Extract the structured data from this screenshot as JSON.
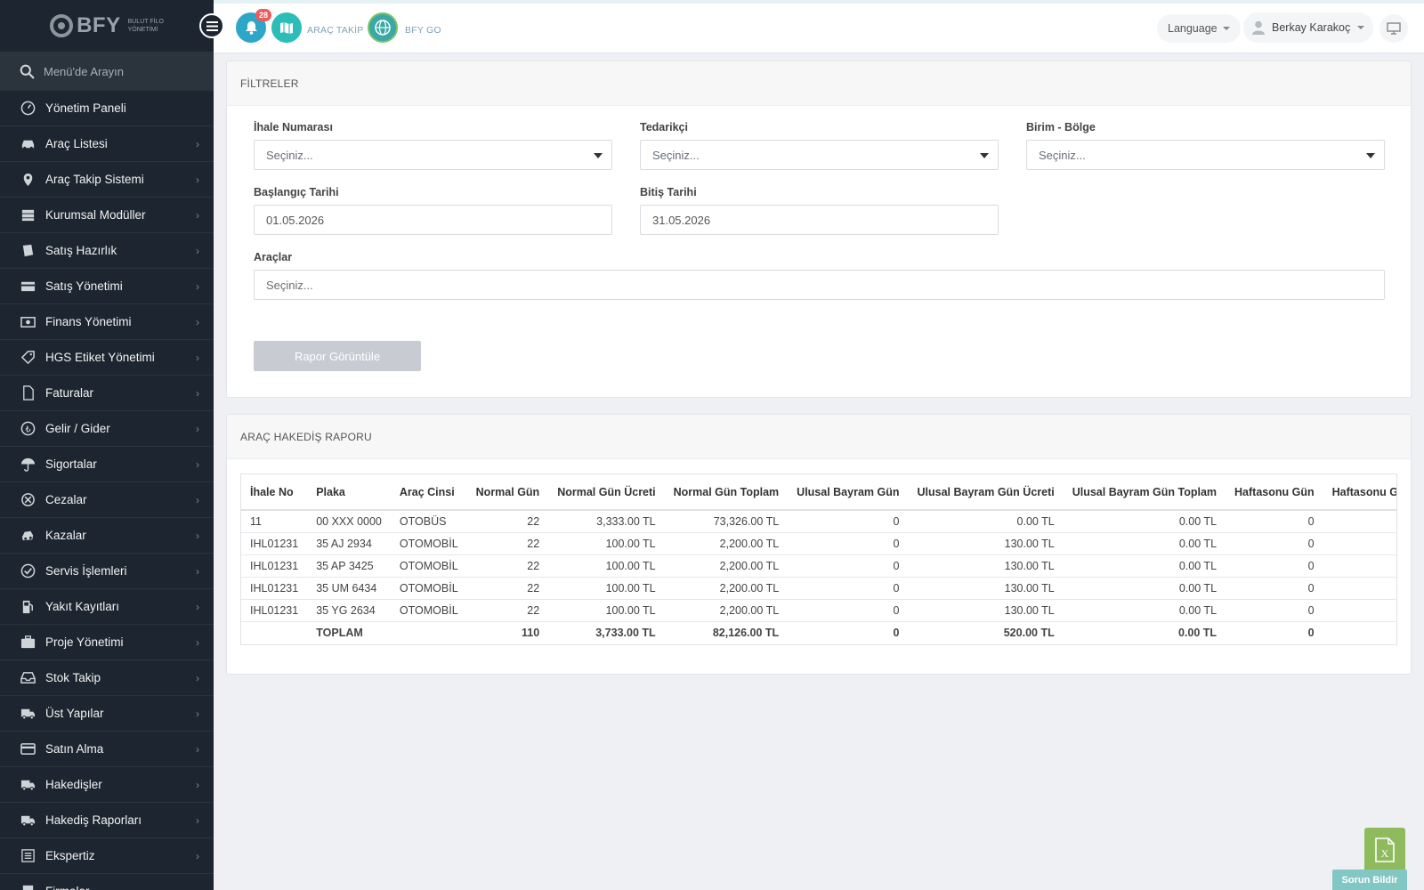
{
  "brand": {
    "name": "BFY",
    "subtitle_line1": "BULUT FİLO",
    "subtitle_line2": "YÖNETİMİ"
  },
  "sidebar": {
    "search_placeholder": "Menü'de Arayın",
    "items": [
      {
        "label": "Yönetim Paneli",
        "icon": "dashboard-icon",
        "has_children": false
      },
      {
        "label": "Araç Listesi",
        "icon": "car-icon",
        "has_children": true
      },
      {
        "label": "Araç Takip Sistemi",
        "icon": "map-pin-icon",
        "has_children": true
      },
      {
        "label": "Kurumsal Modüller",
        "icon": "server-icon",
        "has_children": true
      },
      {
        "label": "Satış Hazırlık",
        "icon": "book-icon",
        "has_children": true
      },
      {
        "label": "Satış Yönetimi",
        "icon": "card-icon",
        "has_children": true
      },
      {
        "label": "Finans Yönetimi",
        "icon": "money-icon",
        "has_children": true
      },
      {
        "label": "HGS Etiket Yönetimi",
        "icon": "tag-icon",
        "has_children": true
      },
      {
        "label": "Faturalar",
        "icon": "file-icon",
        "has_children": true
      },
      {
        "label": "Gelir / Gider",
        "icon": "wallet-icon",
        "has_children": true
      },
      {
        "label": "Sigortalar",
        "icon": "umbrella-icon",
        "has_children": true
      },
      {
        "label": "Cezalar",
        "icon": "ban-icon",
        "has_children": true
      },
      {
        "label": "Kazalar",
        "icon": "car-crash-icon",
        "has_children": true
      },
      {
        "label": "Servis İşlemleri",
        "icon": "check-circle-icon",
        "has_children": true
      },
      {
        "label": "Yakıt Kayıtları",
        "icon": "fuel-icon",
        "has_children": true
      },
      {
        "label": "Proje Yönetimi",
        "icon": "briefcase-icon",
        "has_children": true
      },
      {
        "label": "Stok Takip",
        "icon": "inbox-icon",
        "has_children": true
      },
      {
        "label": "Üst Yapılar",
        "icon": "truck-icon",
        "has_children": true
      },
      {
        "label": "Satın Alma",
        "icon": "credit-card-icon",
        "has_children": true
      },
      {
        "label": "Hakedişler",
        "icon": "truck-icon",
        "has_children": true
      },
      {
        "label": "Hakediş Raporları",
        "icon": "truck-icon",
        "has_children": true
      },
      {
        "label": "Ekspertiz",
        "icon": "list-icon",
        "has_children": true
      },
      {
        "label": "Firmalar",
        "icon": "building-icon",
        "has_children": true
      }
    ]
  },
  "topbar": {
    "notification_count": "28",
    "arac_takip_label": "ARAÇ TAKİP",
    "bfy_go_label": "BFY GO",
    "language_label": "Language",
    "user_name": "Berkay Karakoç"
  },
  "filters": {
    "title": "FİLTRELER",
    "ihale_label": "İhale Numarası",
    "ihale_placeholder": "Seçiniz...",
    "tedarikci_label": "Tedarikçi",
    "tedarikci_placeholder": "Seçiniz...",
    "birim_label": "Birim - Bölge",
    "birim_placeholder": "Seçiniz...",
    "start_label": "Başlangıç Tarihi",
    "start_value": "01.05.2026",
    "end_label": "Bitiş Tarihi",
    "end_value": "31.05.2026",
    "araclar_label": "Araçlar",
    "araclar_placeholder": "Seçiniz...",
    "submit_label": "Rapor Görüntüle"
  },
  "report": {
    "title": "ARAÇ HAKEDİŞ RAPORU",
    "columns": [
      "İhale No",
      "Plaka",
      "Araç Cinsi",
      "Normal Gün",
      "Normal Gün Ücreti",
      "Normal Gün Toplam",
      "Ulusal Bayram Gün",
      "Ulusal Bayram Gün Ücreti",
      "Ulusal Bayram Gün Toplam",
      "Haftasonu Gün",
      "Haftasonu Gün Ücreti"
    ],
    "rows": [
      [
        "11",
        "00 XXX 0000",
        "OTOBÜS",
        "22",
        "3,333.00 TL",
        "73,326.00 TL",
        "0",
        "0.00 TL",
        "0.00 TL",
        "0",
        ""
      ],
      [
        "IHL01231",
        "35 AJ 2934",
        "OTOMOBİL",
        "22",
        "100.00 TL",
        "2,200.00 TL",
        "0",
        "130.00 TL",
        "0.00 TL",
        "0",
        ""
      ],
      [
        "IHL01231",
        "35 AP 3425",
        "OTOMOBİL",
        "22",
        "100.00 TL",
        "2,200.00 TL",
        "0",
        "130.00 TL",
        "0.00 TL",
        "0",
        ""
      ],
      [
        "IHL01231",
        "35 UM 6434",
        "OTOMOBİL",
        "22",
        "100.00 TL",
        "2,200.00 TL",
        "0",
        "130.00 TL",
        "0.00 TL",
        "0",
        ""
      ],
      [
        "IHL01231",
        "35 YG 2634",
        "OTOMOBİL",
        "22",
        "100.00 TL",
        "2,200.00 TL",
        "0",
        "130.00 TL",
        "0.00 TL",
        "0",
        ""
      ]
    ],
    "total": [
      "",
      "TOPLAM",
      "",
      "110",
      "3,733.00 TL",
      "82,126.00 TL",
      "0",
      "520.00 TL",
      "0.00 TL",
      "0",
      ""
    ]
  },
  "footer": {
    "issue_label": "Sorun Bildir"
  },
  "colors": {
    "sidebar_bg": "#1d2630",
    "accent_teal": "#2bbdb7",
    "bell_blue": "#2ea6c8",
    "badge_red": "#e85d5d",
    "excel_green": "#8fbb5e"
  }
}
